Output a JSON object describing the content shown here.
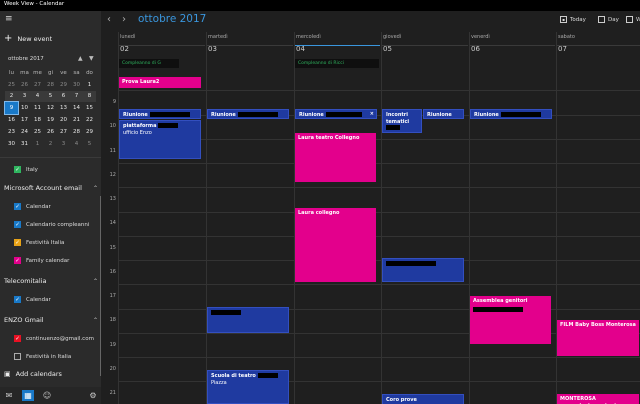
{
  "window": {
    "title": "Week View - Calendar"
  },
  "sidebar": {
    "new_event": "New event",
    "mini_month": "ottobre 2017",
    "weekdays": [
      "lu",
      "ma",
      "me",
      "gi",
      "ve",
      "sa",
      "do"
    ],
    "weeks": [
      [
        "25",
        "26",
        "27",
        "28",
        "29",
        "30",
        "1"
      ],
      [
        "2",
        "3",
        "4",
        "5",
        "6",
        "7",
        "8"
      ],
      [
        "9",
        "10",
        "11",
        "12",
        "13",
        "14",
        "15"
      ],
      [
        "16",
        "17",
        "18",
        "19",
        "20",
        "21",
        "22"
      ],
      [
        "23",
        "24",
        "25",
        "26",
        "27",
        "28",
        "29"
      ],
      [
        "30",
        "31",
        "1",
        "2",
        "3",
        "4",
        "5"
      ]
    ],
    "groups": {
      "italy_cal": "Italy",
      "ms_account": "Microsoft Account email",
      "ms_calendars": [
        "Calendar",
        "Calendario compleanni",
        "Festività Italia",
        "Family calendar"
      ],
      "telecom": "Telecomitalia",
      "telecom_calendars": [
        "Calendar"
      ],
      "gmail": "ENZO Gmail",
      "gmail_calendars": [
        "continuenzo@gmail.com",
        "Festività in Italia"
      ]
    },
    "add_calendars": "Add calendars",
    "colors": {
      "calendar": "#1979c8",
      "compleanni": "#1979c8",
      "festivita": "#e8a317",
      "family": "#e3008c",
      "italy": "#2fb55f",
      "gmail": "#e81123"
    }
  },
  "toolbar": {
    "month_title": "ottobre 2017",
    "today_label": "Today",
    "day_label": "Day",
    "week_label": "W"
  },
  "days": [
    {
      "name": "lunedì",
      "date": "02",
      "allday": "Compleanno di G"
    },
    {
      "name": "martedì",
      "date": "03",
      "allday": ""
    },
    {
      "name": "mercoledì",
      "date": "04",
      "allday": "Compleanno di Ricci"
    },
    {
      "name": "giovedì",
      "date": "05",
      "allday": ""
    },
    {
      "name": "venerdì",
      "date": "06",
      "allday": ""
    },
    {
      "name": "sabato",
      "date": "07",
      "allday": ""
    }
  ],
  "hours": [
    "9",
    "10",
    "11",
    "12",
    "13",
    "14",
    "15",
    "16",
    "17",
    "18",
    "19",
    "20",
    "21"
  ],
  "events": {
    "prova": "Prova Laura2",
    "riunione": "Riunione",
    "incontri": "Incontri tematici",
    "piattaforma": "piattaforma",
    "ufficio": "ufficio Enzo",
    "teatro_collegno": "Laura teatro Collegno",
    "laura_collegno": "Laura collegno",
    "assemblea": "Assemblea genitori",
    "film": "FILM Baby Boss Monterosa",
    "scuola_teatro": "Scuola di teatro",
    "piazza": "Piazza",
    "coro": "Coro prove",
    "monterosa": "MONTEROSA presentazione stagione"
  }
}
